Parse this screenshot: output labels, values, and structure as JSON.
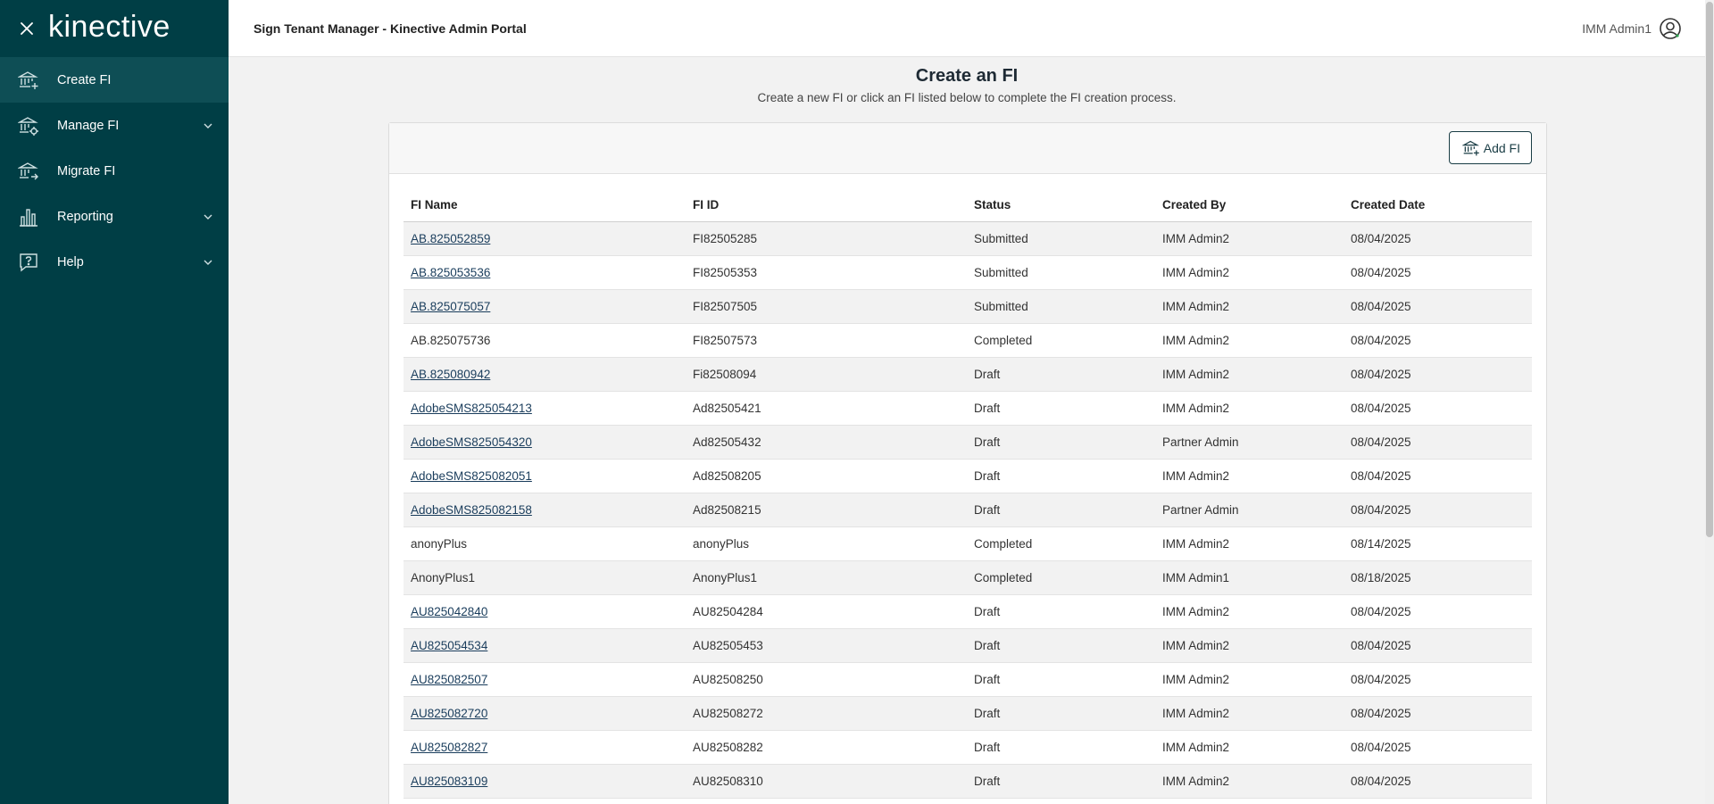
{
  "sidebar": {
    "logo": "kinective",
    "items": [
      {
        "label": "Create FI",
        "icon": "bank-add-icon",
        "active": true,
        "expandable": false
      },
      {
        "label": "Manage FI",
        "icon": "bank-gear-icon",
        "active": false,
        "expandable": true
      },
      {
        "label": "Migrate FI",
        "icon": "bank-migrate-icon",
        "active": false,
        "expandable": false
      },
      {
        "label": "Reporting",
        "icon": "bar-chart-icon",
        "active": false,
        "expandable": true
      },
      {
        "label": "Help",
        "icon": "help-bubble-icon",
        "active": false,
        "expandable": true
      }
    ]
  },
  "header": {
    "title": "Sign Tenant Manager - Kinective Admin Portal",
    "user": "IMM Admin1"
  },
  "main": {
    "title": "Create an FI",
    "subtitle": "Create a new FI or click an FI listed below to complete the FI creation process.",
    "add_button_label": "Add FI",
    "table": {
      "columns": [
        "FI Name",
        "FI ID",
        "Status",
        "Created By",
        "Created Date"
      ],
      "rows": [
        {
          "name": "AB.825052859",
          "id": "FI82505285",
          "status": "Submitted",
          "created_by": "IMM Admin2",
          "date": "08/04/2025",
          "link": true
        },
        {
          "name": "AB.825053536",
          "id": "FI82505353",
          "status": "Submitted",
          "created_by": "IMM Admin2",
          "date": "08/04/2025",
          "link": true
        },
        {
          "name": "AB.825075057",
          "id": "FI82507505",
          "status": "Submitted",
          "created_by": "IMM Admin2",
          "date": "08/04/2025",
          "link": true
        },
        {
          "name": "AB.825075736",
          "id": "FI82507573",
          "status": "Completed",
          "created_by": "IMM Admin2",
          "date": "08/04/2025",
          "link": false
        },
        {
          "name": "AB.825080942",
          "id": "Fi82508094",
          "status": "Draft",
          "created_by": "IMM Admin2",
          "date": "08/04/2025",
          "link": true
        },
        {
          "name": "AdobeSMS825054213",
          "id": "Ad82505421",
          "status": "Draft",
          "created_by": "IMM Admin2",
          "date": "08/04/2025",
          "link": true
        },
        {
          "name": "AdobeSMS825054320",
          "id": "Ad82505432",
          "status": "Draft",
          "created_by": "Partner Admin",
          "date": "08/04/2025",
          "link": true
        },
        {
          "name": "AdobeSMS825082051",
          "id": "Ad82508205",
          "status": "Draft",
          "created_by": "IMM Admin2",
          "date": "08/04/2025",
          "link": true
        },
        {
          "name": "AdobeSMS825082158",
          "id": "Ad82508215",
          "status": "Draft",
          "created_by": "Partner Admin",
          "date": "08/04/2025",
          "link": true
        },
        {
          "name": "anonyPlus",
          "id": "anonyPlus",
          "status": "Completed",
          "created_by": "IMM Admin2",
          "date": "08/14/2025",
          "link": false
        },
        {
          "name": "AnonyPlus1",
          "id": "AnonyPlus1",
          "status": "Completed",
          "created_by": "IMM Admin1",
          "date": "08/18/2025",
          "link": false
        },
        {
          "name": "AU825042840",
          "id": "AU82504284",
          "status": "Draft",
          "created_by": "IMM Admin2",
          "date": "08/04/2025",
          "link": true
        },
        {
          "name": "AU825054534",
          "id": "AU82505453",
          "status": "Draft",
          "created_by": "IMM Admin2",
          "date": "08/04/2025",
          "link": true
        },
        {
          "name": "AU825082507",
          "id": "AU82508250",
          "status": "Draft",
          "created_by": "IMM Admin2",
          "date": "08/04/2025",
          "link": true
        },
        {
          "name": "AU825082720",
          "id": "AU82508272",
          "status": "Draft",
          "created_by": "IMM Admin2",
          "date": "08/04/2025",
          "link": true
        },
        {
          "name": "AU825082827",
          "id": "AU82508282",
          "status": "Draft",
          "created_by": "IMM Admin2",
          "date": "08/04/2025",
          "link": true
        },
        {
          "name": "AU825083109",
          "id": "AU82508310",
          "status": "Draft",
          "created_by": "IMM Admin2",
          "date": "08/04/2025",
          "link": true
        }
      ]
    }
  },
  "colors": {
    "sidebar_bg": "#003e45",
    "sidebar_active": "#0e4e55",
    "link": "#1a3d5c",
    "row_stripe": "#f2f2f2"
  }
}
